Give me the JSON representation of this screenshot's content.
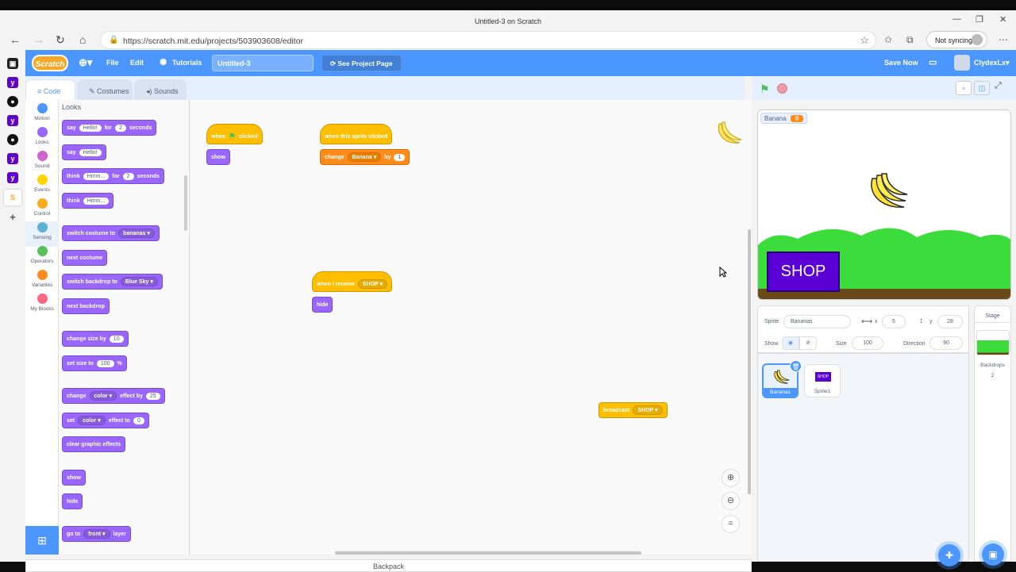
{
  "browser": {
    "window_title": "Untitled-3 on Scratch",
    "url": "https://scratch.mit.edu/projects/503903608/editor",
    "sync_label": "Not syncing"
  },
  "menu": {
    "logo": "Scratch",
    "file": "File",
    "edit": "Edit",
    "tutorials": "Tutorials",
    "project_title": "Untitled-3",
    "see_project_page": "See Project Page",
    "save_now": "Save Now",
    "username": "ClydexLx"
  },
  "tabs": {
    "code": "Code",
    "costumes": "Costumes",
    "sounds": "Sounds"
  },
  "categories": [
    {
      "label": "Motion",
      "color": "#4c97ff"
    },
    {
      "label": "Looks",
      "color": "#9966ff"
    },
    {
      "label": "Sound",
      "color": "#cf63cf"
    },
    {
      "label": "Events",
      "color": "#ffd500"
    },
    {
      "label": "Control",
      "color": "#ffab19"
    },
    {
      "label": "Sensing",
      "color": "#5cb1d6"
    },
    {
      "label": "Operators",
      "color": "#59c059"
    },
    {
      "label": "Variables",
      "color": "#ff8c1a"
    },
    {
      "label": "My Blocks",
      "color": "#ff6680"
    }
  ],
  "palette": {
    "heading": "Looks",
    "say_for": {
      "say": "say",
      "text": "Hello!",
      "for": "for",
      "num": "2",
      "seconds": "seconds"
    },
    "say": {
      "say": "say",
      "text": "Hello!"
    },
    "think_for": {
      "think": "think",
      "text": "Hmm...",
      "for": "for",
      "num": "2",
      "seconds": "seconds"
    },
    "think": {
      "think": "think",
      "text": "Hmm..."
    },
    "switch_costume": {
      "label": "switch costume to",
      "value": "bananas"
    },
    "next_costume": "next costume",
    "switch_backdrop": {
      "label": "switch backdrop to",
      "value": "Blue Sky"
    },
    "next_backdrop": "next backdrop",
    "change_size": {
      "label": "change size by",
      "num": "10"
    },
    "set_size": {
      "label": "set size to",
      "num": "100",
      "unit": "%"
    },
    "change_effect": {
      "change": "change",
      "effect": "color",
      "by": "effect by",
      "num": "25"
    },
    "set_effect": {
      "set": "set",
      "effect": "color",
      "to": "effect to",
      "num": "0"
    },
    "clear_effects": "clear graphic effects",
    "show": "show",
    "hide": "hide",
    "go_to": {
      "go": "go to",
      "value": "front",
      "layer": "layer"
    }
  },
  "scripts": {
    "flag_hat": {
      "when": "when",
      "clicked": "clicked"
    },
    "flag_show": "show",
    "sprite_clicked": "when this sprite clicked",
    "change_var": {
      "change": "change",
      "var": "Banana",
      "by": "by",
      "num": "1"
    },
    "receive": {
      "label": "when I receive",
      "msg": "SHOP"
    },
    "receive_hide": "hide",
    "broadcast": {
      "label": "broadcast",
      "msg": "SHOP"
    }
  },
  "zoom": {
    "reset": "="
  },
  "backpack": "Backpack",
  "stage": {
    "monitor_name": "Banana",
    "monitor_value": "8",
    "shop_button": "SHOP"
  },
  "sprite_info": {
    "sprite_label": "Sprite",
    "sprite_name": "Bananas",
    "x_label": "x",
    "x": "5",
    "y_label": "y",
    "y": "28",
    "show_label": "Show",
    "size_label": "Size",
    "size": "100",
    "direction_label": "Direction",
    "direction": "90"
  },
  "sprites": [
    {
      "name": "Bananas",
      "thumb": ""
    },
    {
      "name": "Sprite1",
      "thumb": "SHOP"
    }
  ],
  "stage_panel": {
    "title": "Stage",
    "backdrops_label": "Backdrops",
    "backdrops_count": "2"
  }
}
